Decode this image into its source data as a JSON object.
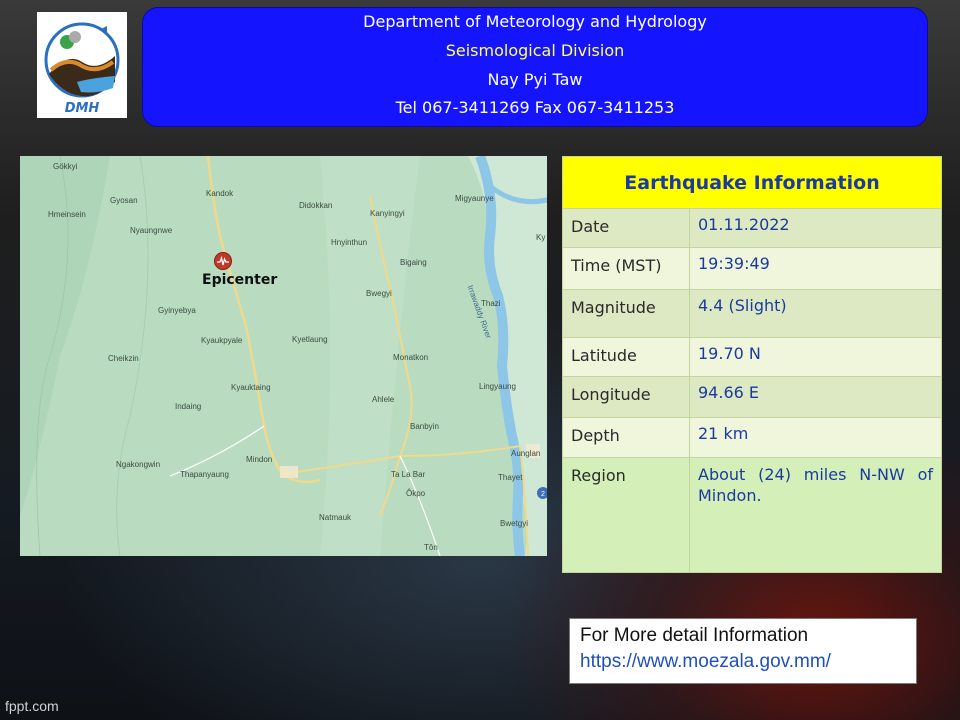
{
  "header": {
    "logo_text": "DMH",
    "line1": "Department of Meteorology and Hydrology",
    "line2": "Seismological Division",
    "line3": "Nay Pyi Taw",
    "line4": "Tel 067-3411269 Fax 067-3411253",
    "accent_color": "#1414ff",
    "highlight_color": "#ffff66"
  },
  "map": {
    "epicenter_label": "Epicenter",
    "river_label": "Irrawaddy River",
    "places": [
      {
        "name": "Gökkyi"
      },
      {
        "name": "Kandok"
      },
      {
        "name": "Gyosan"
      },
      {
        "name": "Didokkan"
      },
      {
        "name": "Kanyingyi"
      },
      {
        "name": "Migyaunye"
      },
      {
        "name": "Hmeinsein"
      },
      {
        "name": "Nyaungnwe"
      },
      {
        "name": "Hnyinthun"
      },
      {
        "name": "Bigaing"
      },
      {
        "name": "Gyinyebya"
      },
      {
        "name": "Bwegyi"
      },
      {
        "name": "Thazi"
      },
      {
        "name": "Kyaukpyale"
      },
      {
        "name": "Kyetlaung"
      },
      {
        "name": "Cheikzin"
      },
      {
        "name": "Monatkon"
      },
      {
        "name": "Kyauktaing"
      },
      {
        "name": "Lingyaung"
      },
      {
        "name": "Ahlele"
      },
      {
        "name": "Indaing"
      },
      {
        "name": "Banbyin"
      },
      {
        "name": "Mindon"
      },
      {
        "name": "Aunglan"
      },
      {
        "name": "Ngakongwin"
      },
      {
        "name": "Thapanyaung"
      },
      {
        "name": "Ta La Bar"
      },
      {
        "name": "Thayet"
      },
      {
        "name": "Ôkpo"
      },
      {
        "name": "Natmauk"
      },
      {
        "name": "Bwetgyi"
      },
      {
        "name": "Tôn"
      },
      {
        "name": "Ky"
      }
    ]
  },
  "info": {
    "title": "Earthquake Information",
    "title_bg": "#ffff00",
    "rows": [
      {
        "label": "Date",
        "value": "01.11.2022"
      },
      {
        "label": "Time (MST)",
        "value": "19:39:49"
      },
      {
        "label": "Magnitude",
        "value": "4.4 (Slight)"
      },
      {
        "label": "Latitude",
        "value": "19.70 N"
      },
      {
        "label": "Longitude",
        "value": "94.66 E"
      },
      {
        "label": "Depth",
        "value": "21 km"
      },
      {
        "label": "Region",
        "value": "About (24) miles N-NW of Mindon."
      }
    ]
  },
  "more": {
    "line1": "For More detail Information",
    "line2": "https://www.moezala.gov.mm/"
  },
  "footer": {
    "brand": "fppt.com"
  }
}
